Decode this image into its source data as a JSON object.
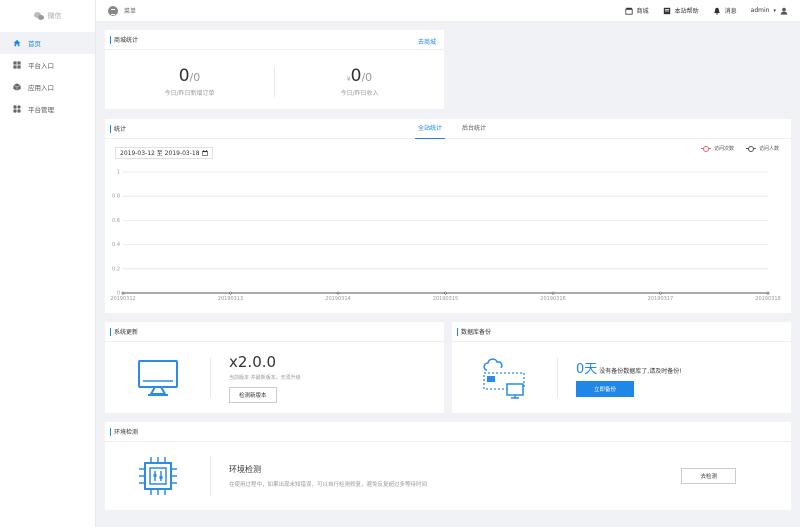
{
  "sidebar": {
    "logo_label": "微信",
    "items": [
      {
        "label": "首页",
        "icon": "home-icon"
      },
      {
        "label": "平台入口",
        "icon": "grid-icon"
      },
      {
        "label": "应用入口",
        "icon": "box-icon"
      },
      {
        "label": "平台管理",
        "icon": "apps-icon"
      }
    ]
  },
  "header": {
    "menu_label": "菜单",
    "shop_label": "商城",
    "help_label": "本站帮助",
    "message_label": "消息",
    "user_label": "admin"
  },
  "mall_stats": {
    "title": "商城统计",
    "link_label": "去商城",
    "orders": {
      "today": "0",
      "yesterday": "/0",
      "label": "今日/昨日新增订单"
    },
    "income": {
      "currency": "¥",
      "today": "0",
      "yesterday": "/0",
      "label": "今日/昨日收入"
    }
  },
  "stats": {
    "title": "统计",
    "tabs": [
      "全站统计",
      "后台统计"
    ],
    "active_tab": 0,
    "date_range": "2019-03-12 至 2019-03-18",
    "legend": [
      "访问次数",
      "访问人数"
    ]
  },
  "chart_data": {
    "type": "line",
    "x": [
      "20190312",
      "20190313",
      "20190314",
      "20190315",
      "20190316",
      "20190317",
      "20190318"
    ],
    "series": [
      {
        "name": "访问次数",
        "color": "#e76a6a",
        "values": [
          0,
          0,
          0,
          0,
          0,
          0,
          0
        ]
      },
      {
        "name": "访问人数",
        "color": "#555555",
        "values": [
          0,
          0,
          0,
          0,
          0,
          0,
          0
        ]
      }
    ],
    "ylim": [
      0,
      1
    ],
    "yticks": [
      "0",
      "0.2",
      "0.4",
      "0.6",
      "0.8",
      "1"
    ],
    "grid": true,
    "legend_position": "top-right"
  },
  "system_update": {
    "title": "系统更新",
    "version": "x2.0.0",
    "sub": "当前版本 并最新版本，无须升级",
    "button": "检测新版本"
  },
  "backup": {
    "title": "数据库备份",
    "days": "0天",
    "text": "没有备份数据库了,请及时备份!",
    "button": "立即备份"
  },
  "env": {
    "title": "环境检测",
    "heading": "环境检测",
    "desc": "在使用过程中，如果出现未知错误，可以自行检测修复，避免反复超过多等待时间",
    "button": "去检测"
  }
}
